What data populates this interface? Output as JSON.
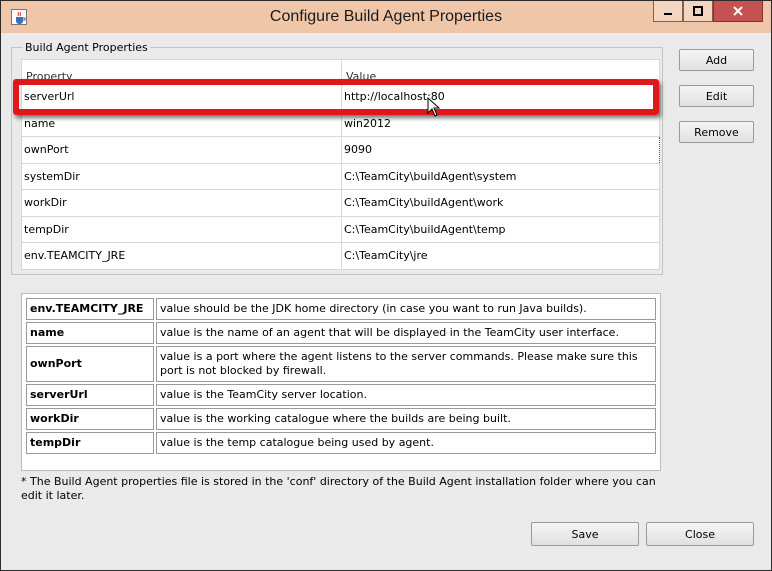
{
  "window": {
    "title": "Configure Build Agent Properties",
    "icon": "java-cup-icon",
    "controls": [
      "minimize-icon",
      "maximize-icon",
      "close-icon"
    ]
  },
  "group_title": "Build Agent Properties",
  "table": {
    "headers": [
      "Property",
      "Value"
    ],
    "rows": [
      {
        "property": "serverUrl",
        "value": "http://localhost:80"
      },
      {
        "property": "name",
        "value": "win2012"
      },
      {
        "property": "ownPort",
        "value": "9090"
      },
      {
        "property": "systemDir",
        "value": "C:\\TeamCity\\buildAgent\\system"
      },
      {
        "property": "workDir",
        "value": "C:\\TeamCity\\buildAgent\\work"
      },
      {
        "property": "tempDir",
        "value": "C:\\TeamCity\\buildAgent\\temp"
      },
      {
        "property": "env.TEAMCITY_JRE",
        "value": "C:\\TeamCity\\jre"
      }
    ]
  },
  "side_buttons": {
    "add": "Add",
    "edit": "Edit",
    "remove": "Remove"
  },
  "help": [
    {
      "key": "env.TEAMCITY_JRE",
      "desc": "value should be the JDK home directory (in case you want to run Java builds)."
    },
    {
      "key": "name",
      "desc": "value is the name of an agent that will be displayed in the TeamCity user interface."
    },
    {
      "key": "ownPort",
      "desc": "value is a port where the agent listens to the server commands. Please make sure this port is not blocked by firewall."
    },
    {
      "key": "serverUrl",
      "desc": "value is the TeamCity server location."
    },
    {
      "key": "workDir",
      "desc": "value is the working catalogue where the builds are being built."
    },
    {
      "key": "tempDir",
      "desc": "value is the temp catalogue being used by agent."
    }
  ],
  "footnote": "* The Build Agent properties file is stored in the 'conf' directory of the Build Agent installation folder where you can edit it later.",
  "bottom_buttons": {
    "save": "Save",
    "close": "Close"
  },
  "colors": {
    "titlebar": "#f0c6a8",
    "highlight": "#e0161d",
    "close_button": "#c75050"
  }
}
